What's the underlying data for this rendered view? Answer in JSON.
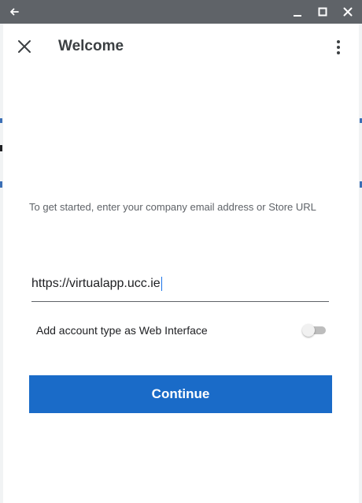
{
  "titlebar": {
    "back_icon": "arrow-left-icon",
    "minimize_icon": "minimize-icon",
    "maximize_icon": "maximize-icon",
    "close_icon": "close-icon"
  },
  "appbar": {
    "close_icon": "close-x-icon",
    "title": "Welcome",
    "menu_icon": "more-vertical-icon"
  },
  "main": {
    "instructions": "To get started, enter your company email address or Store URL",
    "url_value": "https://virtualapp.ucc.ie",
    "toggle_label": "Add account type as Web Interface",
    "toggle_on": false,
    "continue_label": "Continue"
  },
  "colors": {
    "titlebar_bg": "#5f6368",
    "accent": "#1a6bc8",
    "text_primary": "#202124",
    "text_secondary": "#5f6368"
  }
}
